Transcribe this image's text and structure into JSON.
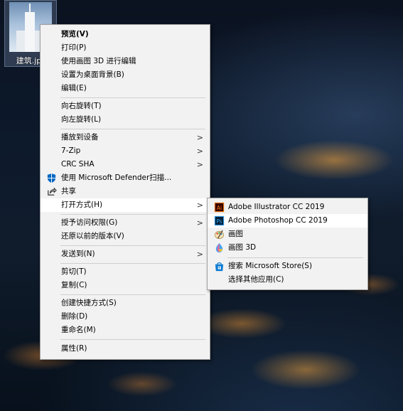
{
  "desktop": {
    "file_label": "建筑.jpg"
  },
  "context_menu": {
    "items": [
      {
        "label": "预览(V)"
      },
      {
        "label": "打印(P)"
      },
      {
        "label": "使用画图 3D 进行编辑"
      },
      {
        "label": "设置为桌面背景(B)"
      },
      {
        "label": "编辑(E)"
      },
      {
        "label": "向右旋转(T)"
      },
      {
        "label": "向左旋转(L)"
      },
      {
        "label": "播放到设备"
      },
      {
        "label": "7-Zip"
      },
      {
        "label": "CRC SHA"
      },
      {
        "label": "使用 Microsoft Defender扫描..."
      },
      {
        "label": "共享"
      },
      {
        "label": "打开方式(H)"
      },
      {
        "label": "授予访问权限(G)"
      },
      {
        "label": "还原以前的版本(V)"
      },
      {
        "label": "发送到(N)"
      },
      {
        "label": "剪切(T)"
      },
      {
        "label": "复制(C)"
      },
      {
        "label": "创建快捷方式(S)"
      },
      {
        "label": "删除(D)"
      },
      {
        "label": "重命名(M)"
      },
      {
        "label": "属性(R)"
      }
    ],
    "submenu_arrow": ">"
  },
  "open_with_menu": {
    "items": [
      {
        "label": "Adobe Illustrator CC 2019",
        "icon_text": "Ai"
      },
      {
        "label": "Adobe Photoshop CC 2019",
        "icon_text": "Ps"
      },
      {
        "label": "画图"
      },
      {
        "label": "画图 3D"
      },
      {
        "label": "搜索 Microsoft Store(S)"
      },
      {
        "label": "选择其他应用(C)"
      }
    ]
  },
  "icons": {
    "defender": "shield-icon",
    "share": "share-icon",
    "illustrator": "illustrator-icon",
    "photoshop": "photoshop-icon",
    "paint": "paint-icon",
    "paint3d": "paint3d-icon",
    "store": "store-icon"
  },
  "colors": {
    "menu_bg": "#f2f2f2",
    "highlight": "#ffffff",
    "illustrator": "#ff7c00",
    "photoshop": "#31a8ff",
    "defender": "#0067c0"
  }
}
